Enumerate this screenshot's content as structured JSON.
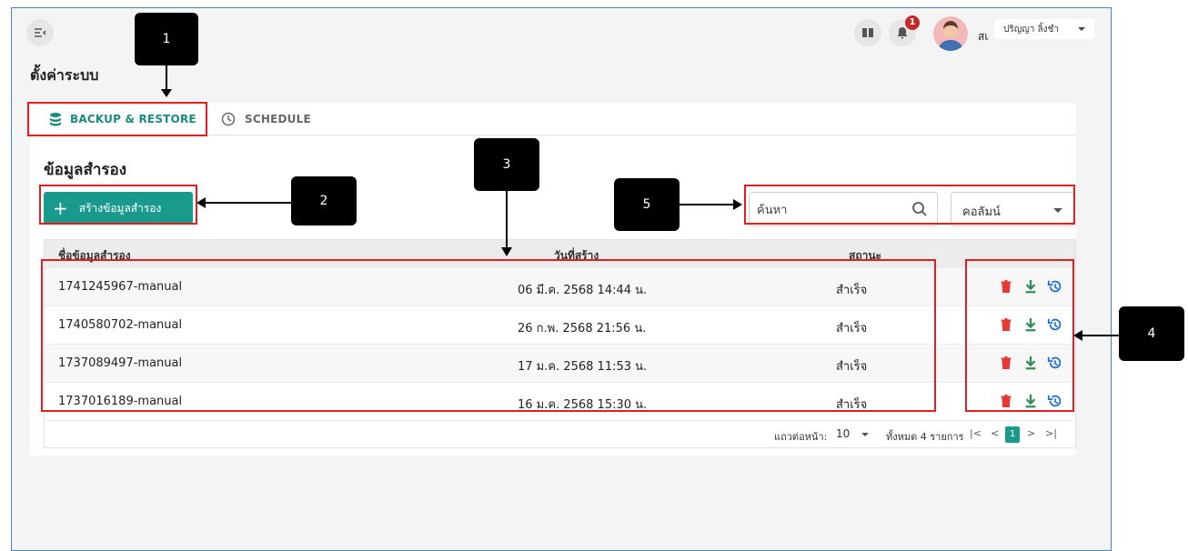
{
  "header": {
    "notification_count": "1",
    "user_name_truncated": "สเ",
    "user_dropdown_label": "ปริญญา ลิ้งชำ"
  },
  "page_title": "ตั้งค่าระบบ",
  "tabs": [
    {
      "label": "BACKUP & RESTORE",
      "icon": "database-icon",
      "active": true
    },
    {
      "label": "SCHEDULE",
      "icon": "clock-icon",
      "active": false
    }
  ],
  "section_title": "ข้อมูลสำรอง",
  "create_button_label": "สร้างข้อมูลสำรอง",
  "search": {
    "placeholder": "ค้นหา"
  },
  "column_select": {
    "value": "คอลัมน์"
  },
  "table": {
    "headers": [
      "ชื่อข้อมูลสำรอง",
      "วันที่สร้าง",
      "สถานะ"
    ],
    "rows": [
      {
        "name": "1741245967-manual",
        "created": "06 มี.ค. 2568 14:44 น.",
        "status": "สำเร็จ"
      },
      {
        "name": "1740580702-manual",
        "created": "26 ก.พ. 2568 21:56 น.",
        "status": "สำเร็จ"
      },
      {
        "name": "1737089497-manual",
        "created": "17 ม.ค. 2568 11:53 น.",
        "status": "สำเร็จ"
      },
      {
        "name": "1737016189-manual",
        "created": "16 ม.ค. 2568 15:30 น.",
        "status": "สำเร็จ"
      }
    ],
    "row_actions": [
      "trash-icon",
      "download-icon",
      "restore-icon"
    ]
  },
  "pagination": {
    "rows_per_page_label": "แถวต่อหน้า:",
    "rows_per_page_value": "10",
    "total_label": "ทั้งหมด 4 รายการ",
    "first": "|<",
    "prev": "<",
    "current_page": "1",
    "next": ">",
    "last": ">|"
  },
  "callouts": [
    "1",
    "2",
    "3",
    "4",
    "5"
  ],
  "colors": {
    "accent": "#1a9a8c",
    "danger": "#e53935",
    "restore": "#1e6fd9",
    "highlight": "#e02020"
  }
}
